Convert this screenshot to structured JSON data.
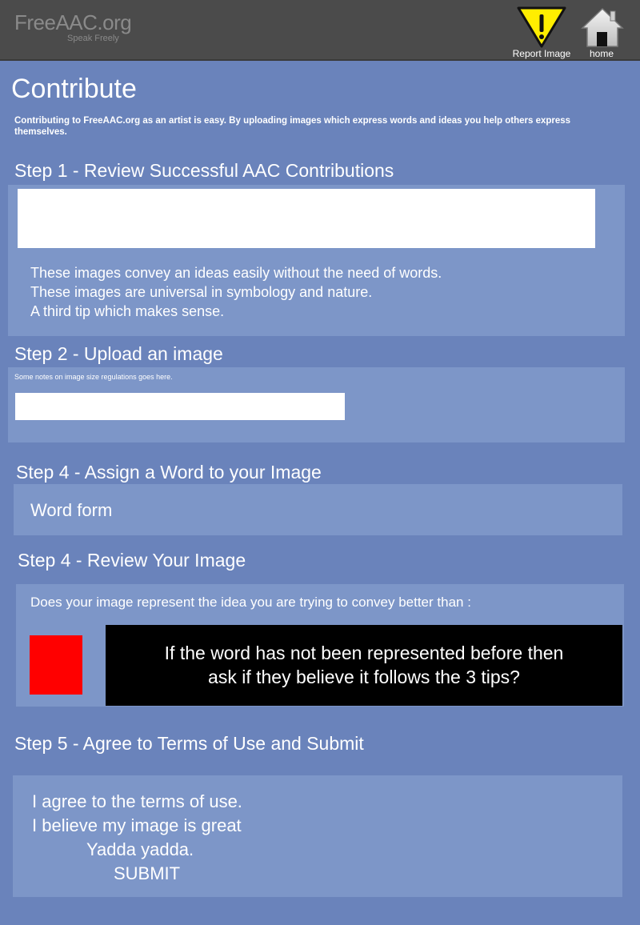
{
  "header": {
    "logo": "FreeAAC.org",
    "tagline": "Speak Freely",
    "report_label": "Report Image",
    "home_label": "home",
    "report_icon": "warning-icon",
    "home_icon": "home-icon",
    "accent_yellow": "#ffee00"
  },
  "page": {
    "title": "Contribute",
    "intro": "Contributing to FreeAAC.org as an artist is easy.  By uploading images which express words and ideas you help others express themselves."
  },
  "step1": {
    "heading": "Step 1 - Review Successful AAC Contributions",
    "tips": [
      "These images convey an ideas easily without the need of words.",
      "These images are universal in symbology and nature.",
      "A third tip which makes sense."
    ]
  },
  "step2": {
    "heading": "Step 2 - Upload an image",
    "notes": "Some notes on image size regulations goes here."
  },
  "step3": {
    "heading": "Step 4 - Assign a Word to your Image",
    "word_form": "Word form"
  },
  "step4": {
    "heading": "Step 4 - Review Your Image",
    "question": "Does your image represent the idea you are trying to convey better than :",
    "message_line1": "If the word has not been represented before then",
    "message_line2": "ask if they believe it follows the 3 tips?"
  },
  "step5": {
    "heading": "Step 5 - Agree to Terms of Use and Submit",
    "line1": "I agree to the terms of use.",
    "line2": "I believe my image is great",
    "line3": "Yadda yadda.",
    "submit": "SUBMIT"
  },
  "colors": {
    "background": "#6a83bb",
    "panel": "#7d96c8",
    "header": "#4b4b4b",
    "red_sample": "#ff0000"
  }
}
